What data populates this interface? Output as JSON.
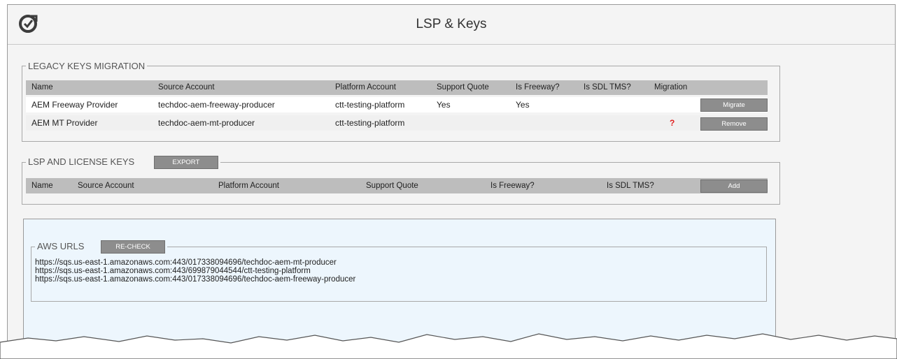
{
  "header": {
    "title": "LSP & Keys",
    "logo_icon": "refresh-check-icon"
  },
  "legacy": {
    "legend": "LEGACY KEYS MIGRATION",
    "columns": [
      "Name",
      "Source Account",
      "Platform Account",
      "Support Quote",
      "Is Freeway?",
      "Is SDL TMS?",
      "Migration"
    ],
    "rows": [
      {
        "name": "AEM Freeway Provider",
        "source": "techdoc-aem-freeway-producer",
        "platform": "ctt-testing-platform",
        "support_quote": "Yes",
        "freeway": "Yes",
        "sdltms": "",
        "migration": "",
        "action": "Migrate"
      },
      {
        "name": "AEM MT Provider",
        "source": "techdoc-aem-mt-producer",
        "platform": "ctt-testing-platform",
        "support_quote": "",
        "freeway": "",
        "sdltms": "",
        "migration": "?",
        "action": "Remove"
      }
    ]
  },
  "lsp": {
    "legend": "LSP AND LICENSE KEYS",
    "export_label": "EXPORT",
    "columns": [
      "Name",
      "Source Account",
      "Platform Account",
      "Support Quote",
      "Is Freeway?",
      "Is SDL TMS?"
    ],
    "plus": "+",
    "add_label": "Add"
  },
  "aws": {
    "legend": "AWS URLS",
    "recheck_label": "RE-CHECK",
    "urls": [
      "https://sqs.us-east-1.amazonaws.com:443/017338094696/techdoc-aem-mt-producer",
      "https://sqs.us-east-1.amazonaws.com:443/699879044544/ctt-testing-platform",
      "https://sqs.us-east-1.amazonaws.com:443/017338094696/techdoc-aem-freeway-producer"
    ]
  },
  "colors": {
    "button": "#8d8d8d",
    "header_row": "#bdbdbd",
    "aws_panel": "#edf6fd",
    "warning": "#e02020"
  }
}
